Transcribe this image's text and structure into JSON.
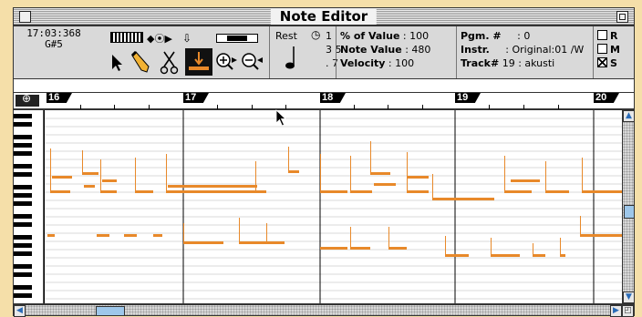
{
  "window": {
    "title": "Note Editor"
  },
  "position": {
    "time": "17:03:368",
    "key": "G#5"
  },
  "tools": {
    "keyboard_icon": "piano-keyboard-icon",
    "pointer_icon": "arrow-pointer-icon",
    "pencil_icon": "pencil-icon",
    "scissors_icon": "scissors-icon",
    "zoom_in_icon": "zoom-in-icon",
    "zoom_out_icon": "zoom-out-icon"
  },
  "note_values": {
    "rest_label": "Rest",
    "row1": "1",
    "row2": "3  5",
    "row3": ".  7"
  },
  "params": {
    "value_pct_label": "% of Value",
    "value_pct": ": 100",
    "note_value_label": "Note Value",
    "note_value": ": 480",
    "velocity_label": "Velocity",
    "velocity": ": 100",
    "pgm_label": "Pgm. #",
    "pgm": ":  0",
    "instr_label": "Instr.",
    "instr": ": Original:01 /W",
    "track_label": "Track#",
    "track": " 19 : akusti"
  },
  "flags": {
    "r": "R",
    "m": "M",
    "s": "S"
  },
  "ruler": {
    "bars": [
      "16",
      "17",
      "18",
      "19",
      "20"
    ]
  },
  "colors": {
    "note": "#e8892a",
    "background": "#f5dfa9",
    "scroll_thumb": "#9ec7ea"
  }
}
